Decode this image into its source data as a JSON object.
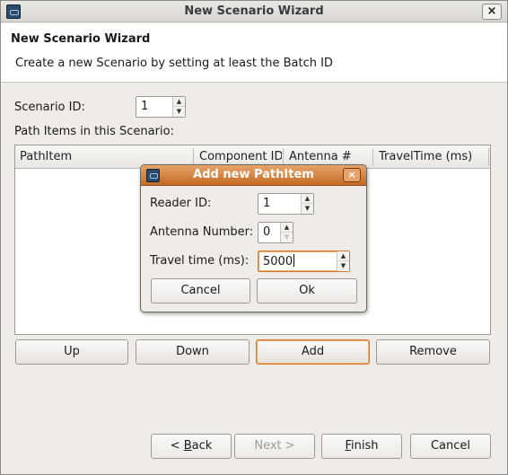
{
  "window": {
    "title": "New Scenario Wizard",
    "close_symbol": "×"
  },
  "header": {
    "title": "New Scenario Wizard",
    "description": "Create a new Scenario by setting at least the Batch ID"
  },
  "form": {
    "scenario_id_label": "Scenario ID:",
    "scenario_id_value": "1",
    "path_items_label": "Path Items in this Scenario:"
  },
  "table": {
    "columns": [
      "PathItem",
      "Component ID",
      "Antenna #",
      "TravelTime (ms)"
    ]
  },
  "table_buttons": {
    "up": "Up",
    "down": "Down",
    "add": "Add",
    "remove": "Remove"
  },
  "wizard_buttons": {
    "back_pre": "< ",
    "back_mnemonic": "B",
    "back_post": "ack",
    "next": "Next >",
    "finish_mnemonic": "F",
    "finish_post": "inish",
    "cancel": "Cancel"
  },
  "dialog": {
    "title": "Add new PathItem",
    "close_symbol": "×",
    "reader_id_label": "Reader ID:",
    "reader_id_value": "1",
    "antenna_label": "Antenna Number:",
    "antenna_value": "0",
    "travel_label": "Travel time (ms):",
    "travel_value": "5000",
    "cancel": "Cancel",
    "ok": "Ok"
  },
  "colors": {
    "accent": "#d57a2d",
    "dialog_title_bg": "#c46a24"
  }
}
